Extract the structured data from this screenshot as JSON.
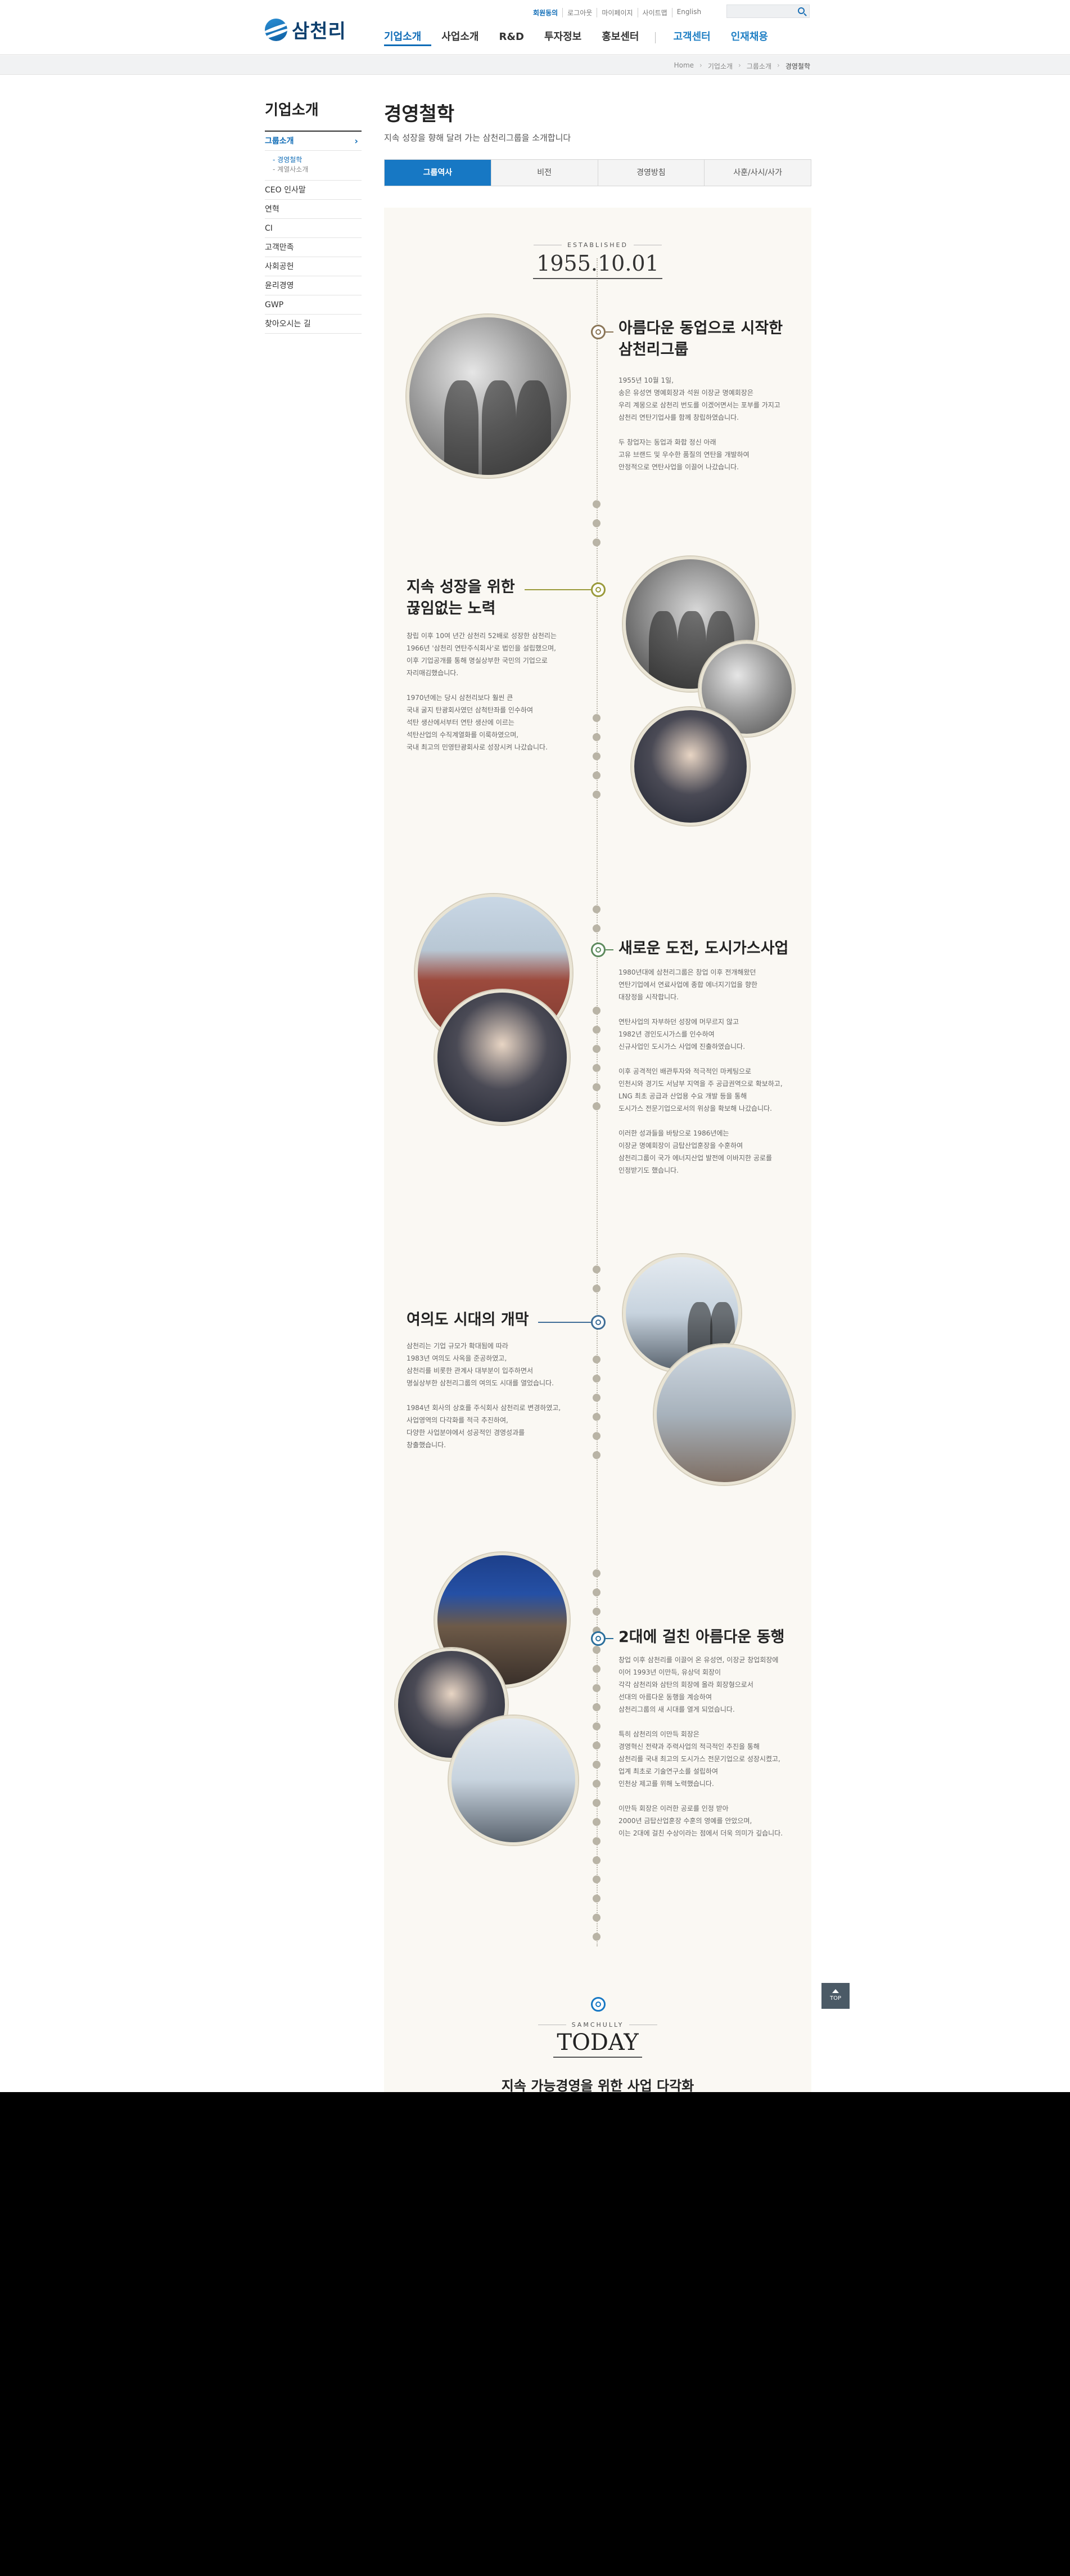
{
  "brand": {
    "logo_text": "삼천리"
  },
  "util_links": [
    "회원동의",
    "로그아웃",
    "마이페이지",
    "사이트맵",
    "English"
  ],
  "search": {
    "placeholder": ""
  },
  "gnb": [
    "기업소개",
    "사업소개",
    "R&D",
    "투자정보",
    "홍보센터",
    "고객센터",
    "인재채용"
  ],
  "breadcrumb": [
    "Home",
    "기업소개",
    "그룹소개",
    "경영철학"
  ],
  "lnb": {
    "title": "기업소개",
    "items": [
      "그룹소개",
      "CEO 인사말",
      "연혁",
      "CI",
      "고객만족",
      "사회공헌",
      "윤리경영",
      "GWP",
      "찾아오시는 길"
    ],
    "sub_items": [
      "경영철학",
      "계열사소개"
    ]
  },
  "content": {
    "title": "경영철학",
    "desc": "지속 성장을 향해 달려 가는 삼천리그룹을 소개합니다",
    "tabs": [
      "그룹역사",
      "비전",
      "경영방침",
      "사훈/사시/사가"
    ]
  },
  "history": {
    "est_label": "ESTABLISHED",
    "est_date": "1955.10.01",
    "sections": [
      {
        "title": "아름다운 동업으로 시작한\n삼천리그룹",
        "body": "1955년 10월 1일,\n송은 유성연 명예회장과 석원 이장균 명예회장은\n우리 계몽으로 삼천리 번도를 이겠어면서는 포부를 가지고\n삼천리 연탄기업사를 함께 창립하였습니다.\n\n두 창업자는 동업과 화합 정신 아래\n고유 브랜드 및 우수한 품질의 연탄을 개발하여\n안정적으로 연탄사업을 이끌어 나갔습니다."
      },
      {
        "title": "지속 성장을 위한\n끊임없는 노력",
        "body": "창립 이후 10여 년간 삼천리 52배로 성장한 삼천리는\n1966년 '삼천리 연탄주식회사'로 법인을 설립했으며,\n이후 기업공개를 통해 명실상부한 국민의 기업으로\n자리매김했습니다.\n\n1970년에는 당시 삼천리보다 훨씬 큰\n국내 굴지 탄광회사였던 삼척탄좌를 인수하여\n석탄 생산에서부터 연탄 생산에 이르는\n석탄산업의 수직계열화를 이룩하였으며,\n국내 최고의 민영탄광회사로 성장시켜 나갔습니다."
      },
      {
        "title": "새로운 도전, 도시가스사업",
        "body": "1980년대에 삼천리그룹은 창업 이후 전개해왔던\n연탄기업에서 연료사업에 종합 에너지기업을 향한\n대장정을 시작합니다.\n\n연탄사업의 자부하던 성장에 머무르지 않고\n1982년 경인도시가스를 인수하여\n신규사업인 도시가스 사업에 진출하였습니다.\n\n이후 공격적인 배관투자와 적극적인 마케팅으로\n인천시와 경기도 서남부 지역을 주 공급권역으로 확보하고,\nLNG 최초 공급과 산업용 수요 개발 등을 통해\n도시가스 전문기업으로서의 위상을 확보해 나갔습니다.\n\n이러한 성과들을 바탕으로 1986년에는\n이장균 명예회장이 금탑산업훈장을 수훈하여\n삼천리그룹이 국가 에너지산업 발전에 이바지한 공로를\n인정받기도 했습니다."
      },
      {
        "title": "여의도 시대의 개막",
        "body": "삼천리는 기업 규모가 확대됨에 따라\n1983년 여의도 사옥을 준공하였고,\n삼천리를 비롯한 관계사 대부분이 입주하면서\n명실상부한 삼천리그룹의 여의도 시대를 열었습니다.\n\n1984년 회사의 상호를 주식회사 삼천리로 변경하였고,\n사업영역의 다각화를 적극 추진하여,\n다양한 사업분야에서 성공적인 경영성과를\n창출했습니다."
      },
      {
        "title": "2대에 걸친 아름다운 동행",
        "body": "창업 이후 삼천리를 이끌어 온 유성연, 이장균 창업회장에\n이어 1993년 이만득, 유상덕 회장이\n각각 삼천리와 삼탄의 회장에 올라 회장형으로서\n선대의 아름다운 동행을 계승하여\n삼천리그룹의 새 시대를 열게 되었습니다.\n\n특히 삼천리의 이만득 회장은\n경영혁신 전략과 주력사업의 적극적인 추진을 통해\n삼천리를 국내 최고의 도시가스 전문기업으로 성장시켰고,\n업계 최초로 기술연구소를 설립하여\n인천상 제고를 위해 노력했습니다.\n\n이만득 회장은 이러한 공로를 인정 받아\n2000년 금탑산업훈장 수훈의 영예를 안았으며,\n이는 2대에 걸친 수상이라는 점에서 더욱 의미가 깊습니다."
      }
    ],
    "today_label": "SAMCHULLY",
    "today_title": "TODAY",
    "today_sub": "지속 가능경영을 위한 사업 다각화"
  },
  "top_button": "TOP"
}
